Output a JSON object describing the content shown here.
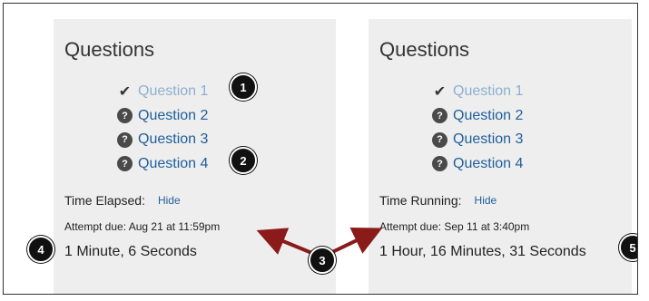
{
  "left_panel": {
    "heading": "Questions",
    "questions": [
      {
        "label": "Question 1",
        "status": "answered"
      },
      {
        "label": "Question 2",
        "status": "unanswered"
      },
      {
        "label": "Question 3",
        "status": "unanswered"
      },
      {
        "label": "Question 4",
        "status": "unanswered"
      }
    ],
    "time_label": "Time Elapsed:",
    "hide_label": "Hide",
    "due_text": "Attempt due: Aug 21 at 11:59pm",
    "time_value": "1 Minute, 6 Seconds"
  },
  "right_panel": {
    "heading": "Questions",
    "questions": [
      {
        "label": "Question 1",
        "status": "answered"
      },
      {
        "label": "Question 2",
        "status": "unanswered"
      },
      {
        "label": "Question 3",
        "status": "unanswered"
      },
      {
        "label": "Question 4",
        "status": "unanswered"
      }
    ],
    "time_label": "Time Running:",
    "hide_label": "Hide",
    "due_text": "Attempt due: Sep 11 at 3:40pm",
    "time_value": "1 Hour, 16 Minutes, 31 Seconds"
  },
  "callouts": [
    "1",
    "2",
    "3",
    "4",
    "5"
  ],
  "icons": {
    "answered": "checkmark-icon",
    "unanswered": "question-mark-icon"
  },
  "colors": {
    "link": "#1f5f9b",
    "answered_link": "#8db0d0",
    "arrow": "#8b1a1a",
    "panel": "#eeeeee"
  }
}
